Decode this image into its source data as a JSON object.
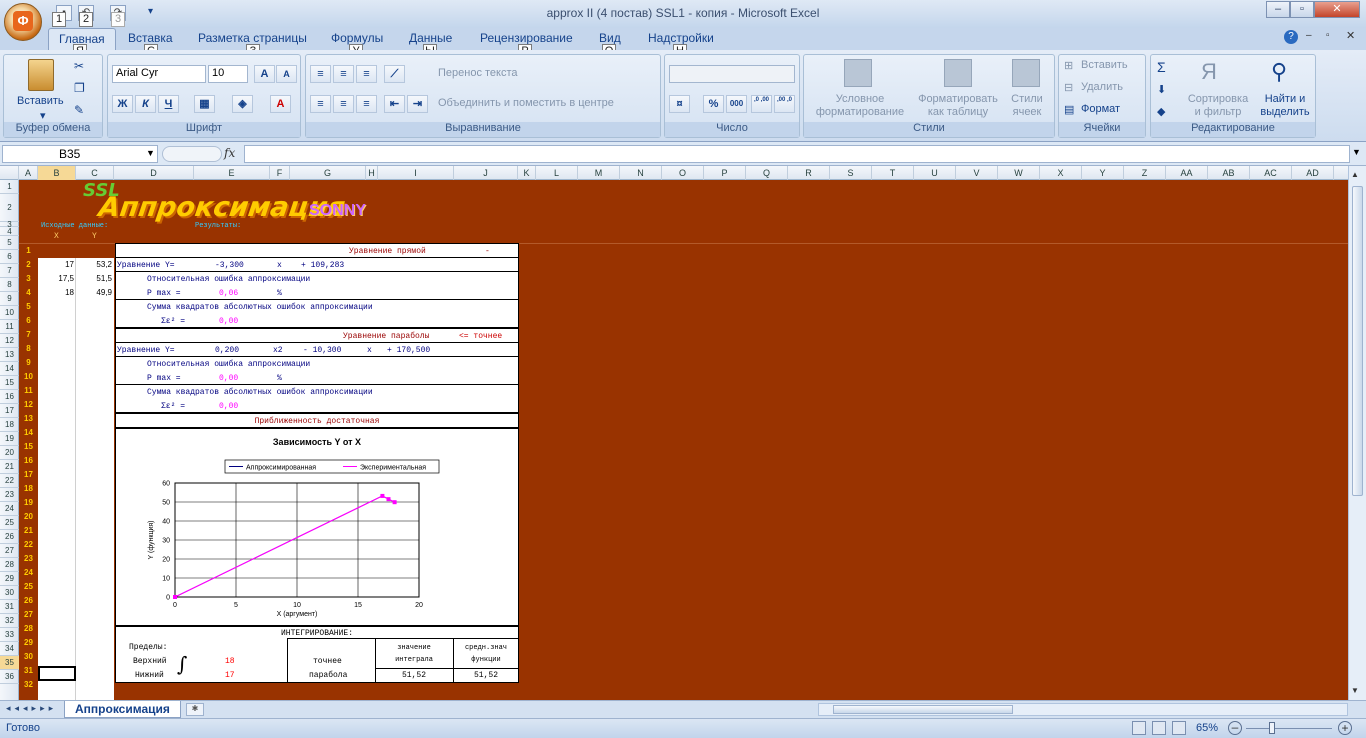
{
  "window": {
    "title": "approx II (4 постав) SSL1 - копия - Microsoft Excel",
    "office_button_key": "Ф",
    "qat_keys": [
      "1",
      "2",
      "3"
    ]
  },
  "tabs": [
    {
      "label": "Главная",
      "key": "Я"
    },
    {
      "label": "Вставка",
      "key": "С"
    },
    {
      "label": "Разметка страницы",
      "key": "З"
    },
    {
      "label": "Формулы",
      "key": "У"
    },
    {
      "label": "Данные",
      "key": "Ы"
    },
    {
      "label": "Рецензирование",
      "key": "Р"
    },
    {
      "label": "Вид",
      "key": "О"
    },
    {
      "label": "Надстройки",
      "key": "Н"
    }
  ],
  "ribbon": {
    "clipboard": {
      "label": "Буфер обмена",
      "paste": "Вставить"
    },
    "font": {
      "label": "Шрифт",
      "font_name": "Arial Cyr",
      "font_size": "10",
      "bold": "Ж",
      "italic": "К",
      "underline": "Ч",
      "grow": "A",
      "shrink": "A",
      "color": "A"
    },
    "alignment": {
      "label": "Выравнивание",
      "wrap": "Перенос текста",
      "merge": "Объединить и поместить в центре"
    },
    "number": {
      "label": "Число",
      "percent": "%",
      "thousands": "000",
      "inc": ",0 ,00",
      "dec": ",00 ,0"
    },
    "styles": {
      "label": "Стили",
      "conditional": "Условное форматирование",
      "format_table": "Форматировать как таблицу",
      "cell_styles": "Стили ячеек"
    },
    "cells": {
      "label": "Ячейки",
      "insert": "Вставить",
      "delete": "Удалить",
      "format": "Формат"
    },
    "editing": {
      "label": "Редактирование",
      "sort": "Сортировка и фильтр",
      "find": "Найти и выделить",
      "sum": "Σ"
    }
  },
  "formula_bar": {
    "name_box": "B35",
    "fx": "fx",
    "value": ""
  },
  "columns": [
    "A",
    "B",
    "C",
    "D",
    "E",
    "F",
    "G",
    "H",
    "I",
    "J",
    "K",
    "L",
    "M",
    "N",
    "O",
    "P",
    "Q",
    "R",
    "S",
    "T",
    "U",
    "V",
    "W",
    "X",
    "Y",
    "Z",
    "AA",
    "AB",
    "AC",
    "AD"
  ],
  "rows": [
    "1",
    "2",
    "3",
    "4",
    "5",
    "6",
    "7",
    "8",
    "9",
    "10",
    "11",
    "12",
    "13",
    "14",
    "15",
    "16",
    "17",
    "18",
    "19",
    "20",
    "21",
    "22",
    "23",
    "24",
    "25",
    "26",
    "27",
    "28",
    "29",
    "30",
    "31",
    "32",
    "33",
    "34",
    "35",
    "36"
  ],
  "sheet": {
    "logo": {
      "ssl": "SSL",
      "title": "Аппроксимация",
      "sonny": "SONNY"
    },
    "src_label": "Исходные данные:",
    "res_label": "Результаты:",
    "x_head": "X",
    "y_head": "Y",
    "index_nums": [
      "1",
      "2",
      "3",
      "4",
      "5",
      "6",
      "7",
      "8",
      "9",
      "10",
      "11",
      "12",
      "13",
      "14",
      "15",
      "16",
      "17",
      "18",
      "19",
      "20",
      "21",
      "22",
      "23",
      "24",
      "25",
      "26",
      "27",
      "28",
      "29",
      "30",
      "31",
      "32"
    ],
    "data": [
      {
        "x": "17",
        "y": "53,2"
      },
      {
        "x": "17,5",
        "y": "51,5"
      },
      {
        "x": "18",
        "y": "49,9"
      }
    ],
    "line": {
      "title": "Уравнение прямой",
      "dash": "-",
      "eq_label": "Уравнение Y=",
      "a": "-3,300",
      "x": "x",
      "b": "+ 109,283",
      "err_label": "Относительная ошибка аппроксимации",
      "pmax_label": "P max =",
      "pmax": "0,06",
      "pct": "%",
      "sum_label": "Сумма квадратов абсолютных ошибок аппроксимации",
      "sum_sym": "Σε² =",
      "sum_val": "0,00"
    },
    "parab": {
      "title": "Уравнение параболы",
      "better": "<= точнее",
      "eq_label": "Уравнение Y=",
      "a": "0,200",
      "x2": "x2",
      "b": "- 10,300",
      "x": "x",
      "c": "+ 170,500",
      "err_label": "Относительная ошибка аппроксимации",
      "pmax_label": "P max =",
      "pmax": "0,00",
      "pct": "%",
      "sum_label": "Сумма квадратов абсолютных ошибок аппроксимации",
      "sum_sym": "Σε² =",
      "sum_val": "0,00"
    },
    "conclusion": "Приближенность достаточная",
    "integ": {
      "title": "ИНТЕГРИРОВАНИЕ:",
      "limits": "Пределы:",
      "upper": "Верхний",
      "upper_val": "18",
      "lower": "Нижний",
      "lower_val": "17",
      "method1": "точнее",
      "method2": "парабола",
      "col1a": "значение",
      "col1b": "интеграла",
      "col2a": "средн.знач",
      "col2b": "функции",
      "v1": "51,52",
      "v2": "51,52"
    }
  },
  "chart_data": {
    "type": "line",
    "title": "Зависимость Y от X",
    "xlabel": "X (аргумент)",
    "ylabel": "Y (функция)",
    "xlim": [
      0,
      20
    ],
    "ylim": [
      0,
      60
    ],
    "xticks": [
      "0",
      "5",
      "10",
      "15",
      "20"
    ],
    "yticks": [
      "0",
      "10",
      "20",
      "30",
      "40",
      "50",
      "60"
    ],
    "legend": "top",
    "series": [
      {
        "name": "Аппроксимированная",
        "color": "#000080",
        "x": [
          0,
          17,
          17.5,
          18
        ],
        "y": [
          0,
          53.2,
          51.5,
          49.9
        ]
      },
      {
        "name": "Экспериментальная",
        "color": "#ff00ff",
        "x": [
          0,
          17,
          17.5,
          18
        ],
        "y": [
          0,
          53.2,
          51.5,
          49.9
        ]
      }
    ]
  },
  "sheet_tab": "Аппроксимация",
  "status": {
    "ready": "Готово",
    "zoom": "65%"
  }
}
